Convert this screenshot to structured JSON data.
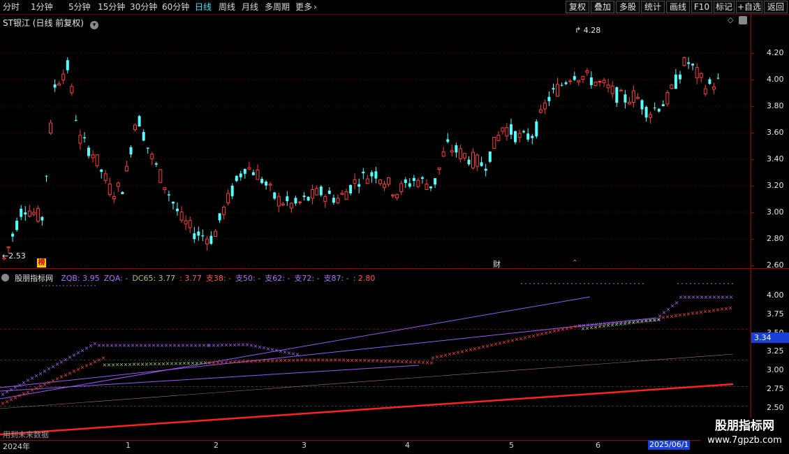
{
  "toolbar": {
    "periods": [
      "分时",
      "1分钟",
      "5分钟",
      "15分钟",
      "30分钟",
      "60分钟",
      "日线",
      "周线",
      "月线",
      "多周期",
      "更多"
    ],
    "active_period": "日线",
    "more_arrow": "›",
    "right_buttons": [
      "复权",
      "叠加",
      "多股",
      "统计",
      "画线",
      "F10",
      "标记",
      "+自选",
      "返回"
    ]
  },
  "main_chart": {
    "title": "ST银江 (日线 前复权)",
    "high_marker": "4.28",
    "low_marker": "2.53",
    "badge_bang": "榜",
    "badge_cai": "财",
    "y_ticks": [
      "4.20",
      "4.00",
      "3.80",
      "3.60",
      "3.40",
      "3.20",
      "3.00",
      "2.80",
      "2.60"
    ],
    "up_color": "#ff3b3b",
    "down_color": "#54ffff"
  },
  "indicator": {
    "name": "股朋指标网",
    "parts": [
      {
        "text": "ZQB: 3.95",
        "color": "#b070ff"
      },
      {
        "text": "ZQA: -",
        "color": "#b070ff"
      },
      {
        "text": "DC65: 3.77",
        "color": "#9acd6a"
      },
      {
        "text": ": 3.77",
        "color": "#ff5555"
      },
      {
        "text": "支38: -",
        "color": "#ff5555"
      },
      {
        "text": "支50: -",
        "color": "#b070ff"
      },
      {
        "text": "支62: -",
        "color": "#b070ff"
      },
      {
        "text": "支72: -",
        "color": "#b070ff"
      },
      {
        "text": "支87: -",
        "color": "#b070ff"
      },
      {
        "text": ": 2.80",
        "color": "#ff5555"
      }
    ],
    "y_ticks": [
      "4.00",
      "3.75",
      "3.50",
      "3.25",
      "3.00",
      "2.75",
      "2.50"
    ],
    "current_value": "3.34",
    "future_note": "用到未来数据"
  },
  "x_axis": {
    "labels": [
      "2024年",
      "1",
      "2",
      "3",
      "4",
      "5",
      "6"
    ],
    "highlight_date": "2025/06/1"
  },
  "watermark": {
    "line1": "股朋指标网",
    "line2": "www.7gpzb.com"
  }
}
